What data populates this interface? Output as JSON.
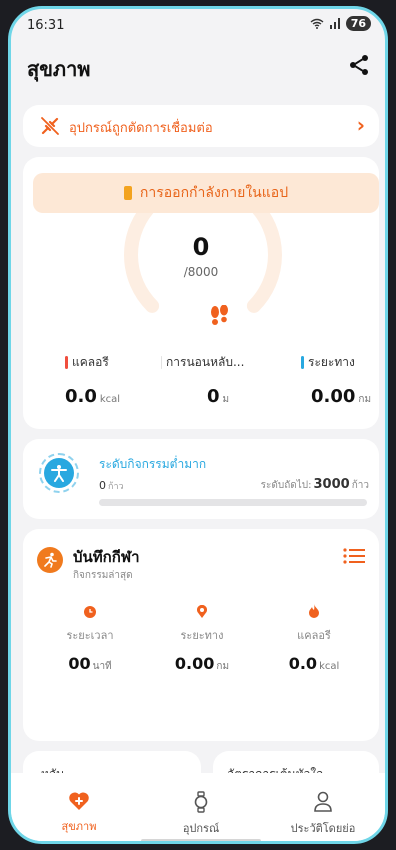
{
  "status_bar": {
    "time": "16:31",
    "battery": "76"
  },
  "header": {
    "title": "สุขภาพ"
  },
  "device_banner": {
    "text": "อุปกรณ์ถูกตัดการเชื่อมต่อ"
  },
  "steps": {
    "count": "0",
    "goal": "/8000",
    "progress": 0
  },
  "metrics": [
    {
      "label": "แคลอรี",
      "value": "0.0",
      "unit": "kcal",
      "color": "#f04e3e"
    },
    {
      "label": "การนอนหลับ...",
      "value": "0",
      "unit": "ม"
    },
    {
      "label": "ระยะทาง",
      "value": "0.00",
      "unit": "กม",
      "color": "#28a8e0"
    }
  ],
  "activity": {
    "title": "ระดับกิจกรรมต่ำมาก",
    "steps": "0",
    "steps_unit": "ก้าว",
    "next_prefix": "ระดับถัดไป:",
    "next_value": "3000",
    "next_unit": "ก้าว",
    "progress": 0
  },
  "sports": {
    "title": "บันทึกกีฬา",
    "subtitle": "กิจกรรมล่าสุด",
    "metrics": [
      {
        "label": "ระยะเวลา",
        "value": "00",
        "unit": "นาที"
      },
      {
        "label": "ระยะทาง",
        "value": "0.00",
        "unit": "กม"
      },
      {
        "label": "แคลอรี",
        "value": "0.0",
        "unit": "kcal"
      }
    ],
    "button": "การออกกำลังกายในแอป"
  },
  "mini_cards": [
    "หลับ",
    "อัตราการเต้นหัวใจ"
  ],
  "tabs": [
    {
      "label": "สุขภาพ",
      "active": true
    },
    {
      "label": "อุปกรณ์",
      "active": false
    },
    {
      "label": "ประวัติโดยย่อ",
      "active": false
    }
  ],
  "colors": {
    "accent": "#f0611e",
    "blue": "#28a8e0",
    "frame": "#6fd6e8"
  }
}
